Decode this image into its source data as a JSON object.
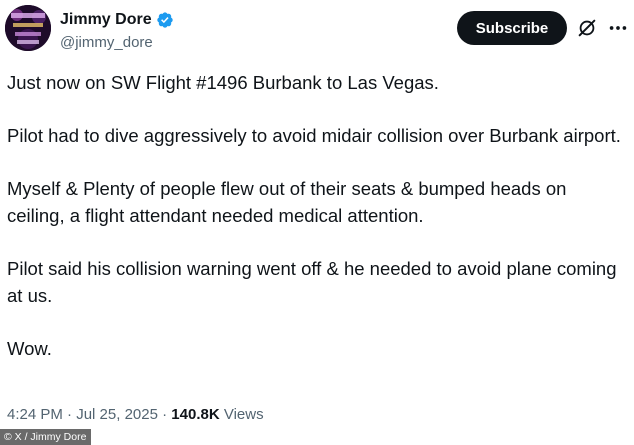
{
  "author": {
    "display_name": "Jimmy Dore",
    "handle": "@jimmy_dore",
    "verified": true,
    "avatar_icon": "comedian-avatar",
    "verified_color": "#1d9bf0"
  },
  "actions": {
    "subscribe_label": "Subscribe",
    "grok_icon": "grok-icon",
    "more_icon": "more-icon"
  },
  "tweet": {
    "paragraphs": [
      "Just now on SW Flight #1496 Burbank to Las Vegas.",
      "Pilot had to dive aggressively to avoid midair collision over Burbank airport.",
      "Myself & Plenty of people flew out of their seats & bumped heads on ceiling, a flight attendant needed medical attention.",
      "Pilot said his collision warning went off & he needed to avoid plane coming at us.",
      "Wow."
    ]
  },
  "meta": {
    "time": "4:24 PM",
    "separator": " · ",
    "date": "Jul 25, 2025",
    "views_count": "140.8K",
    "views_label": "Views"
  },
  "credit": "© X / Jimmy Dore",
  "colors": {
    "text": "#0f1419",
    "secondary": "#536471",
    "button_bg": "#0f1419"
  }
}
